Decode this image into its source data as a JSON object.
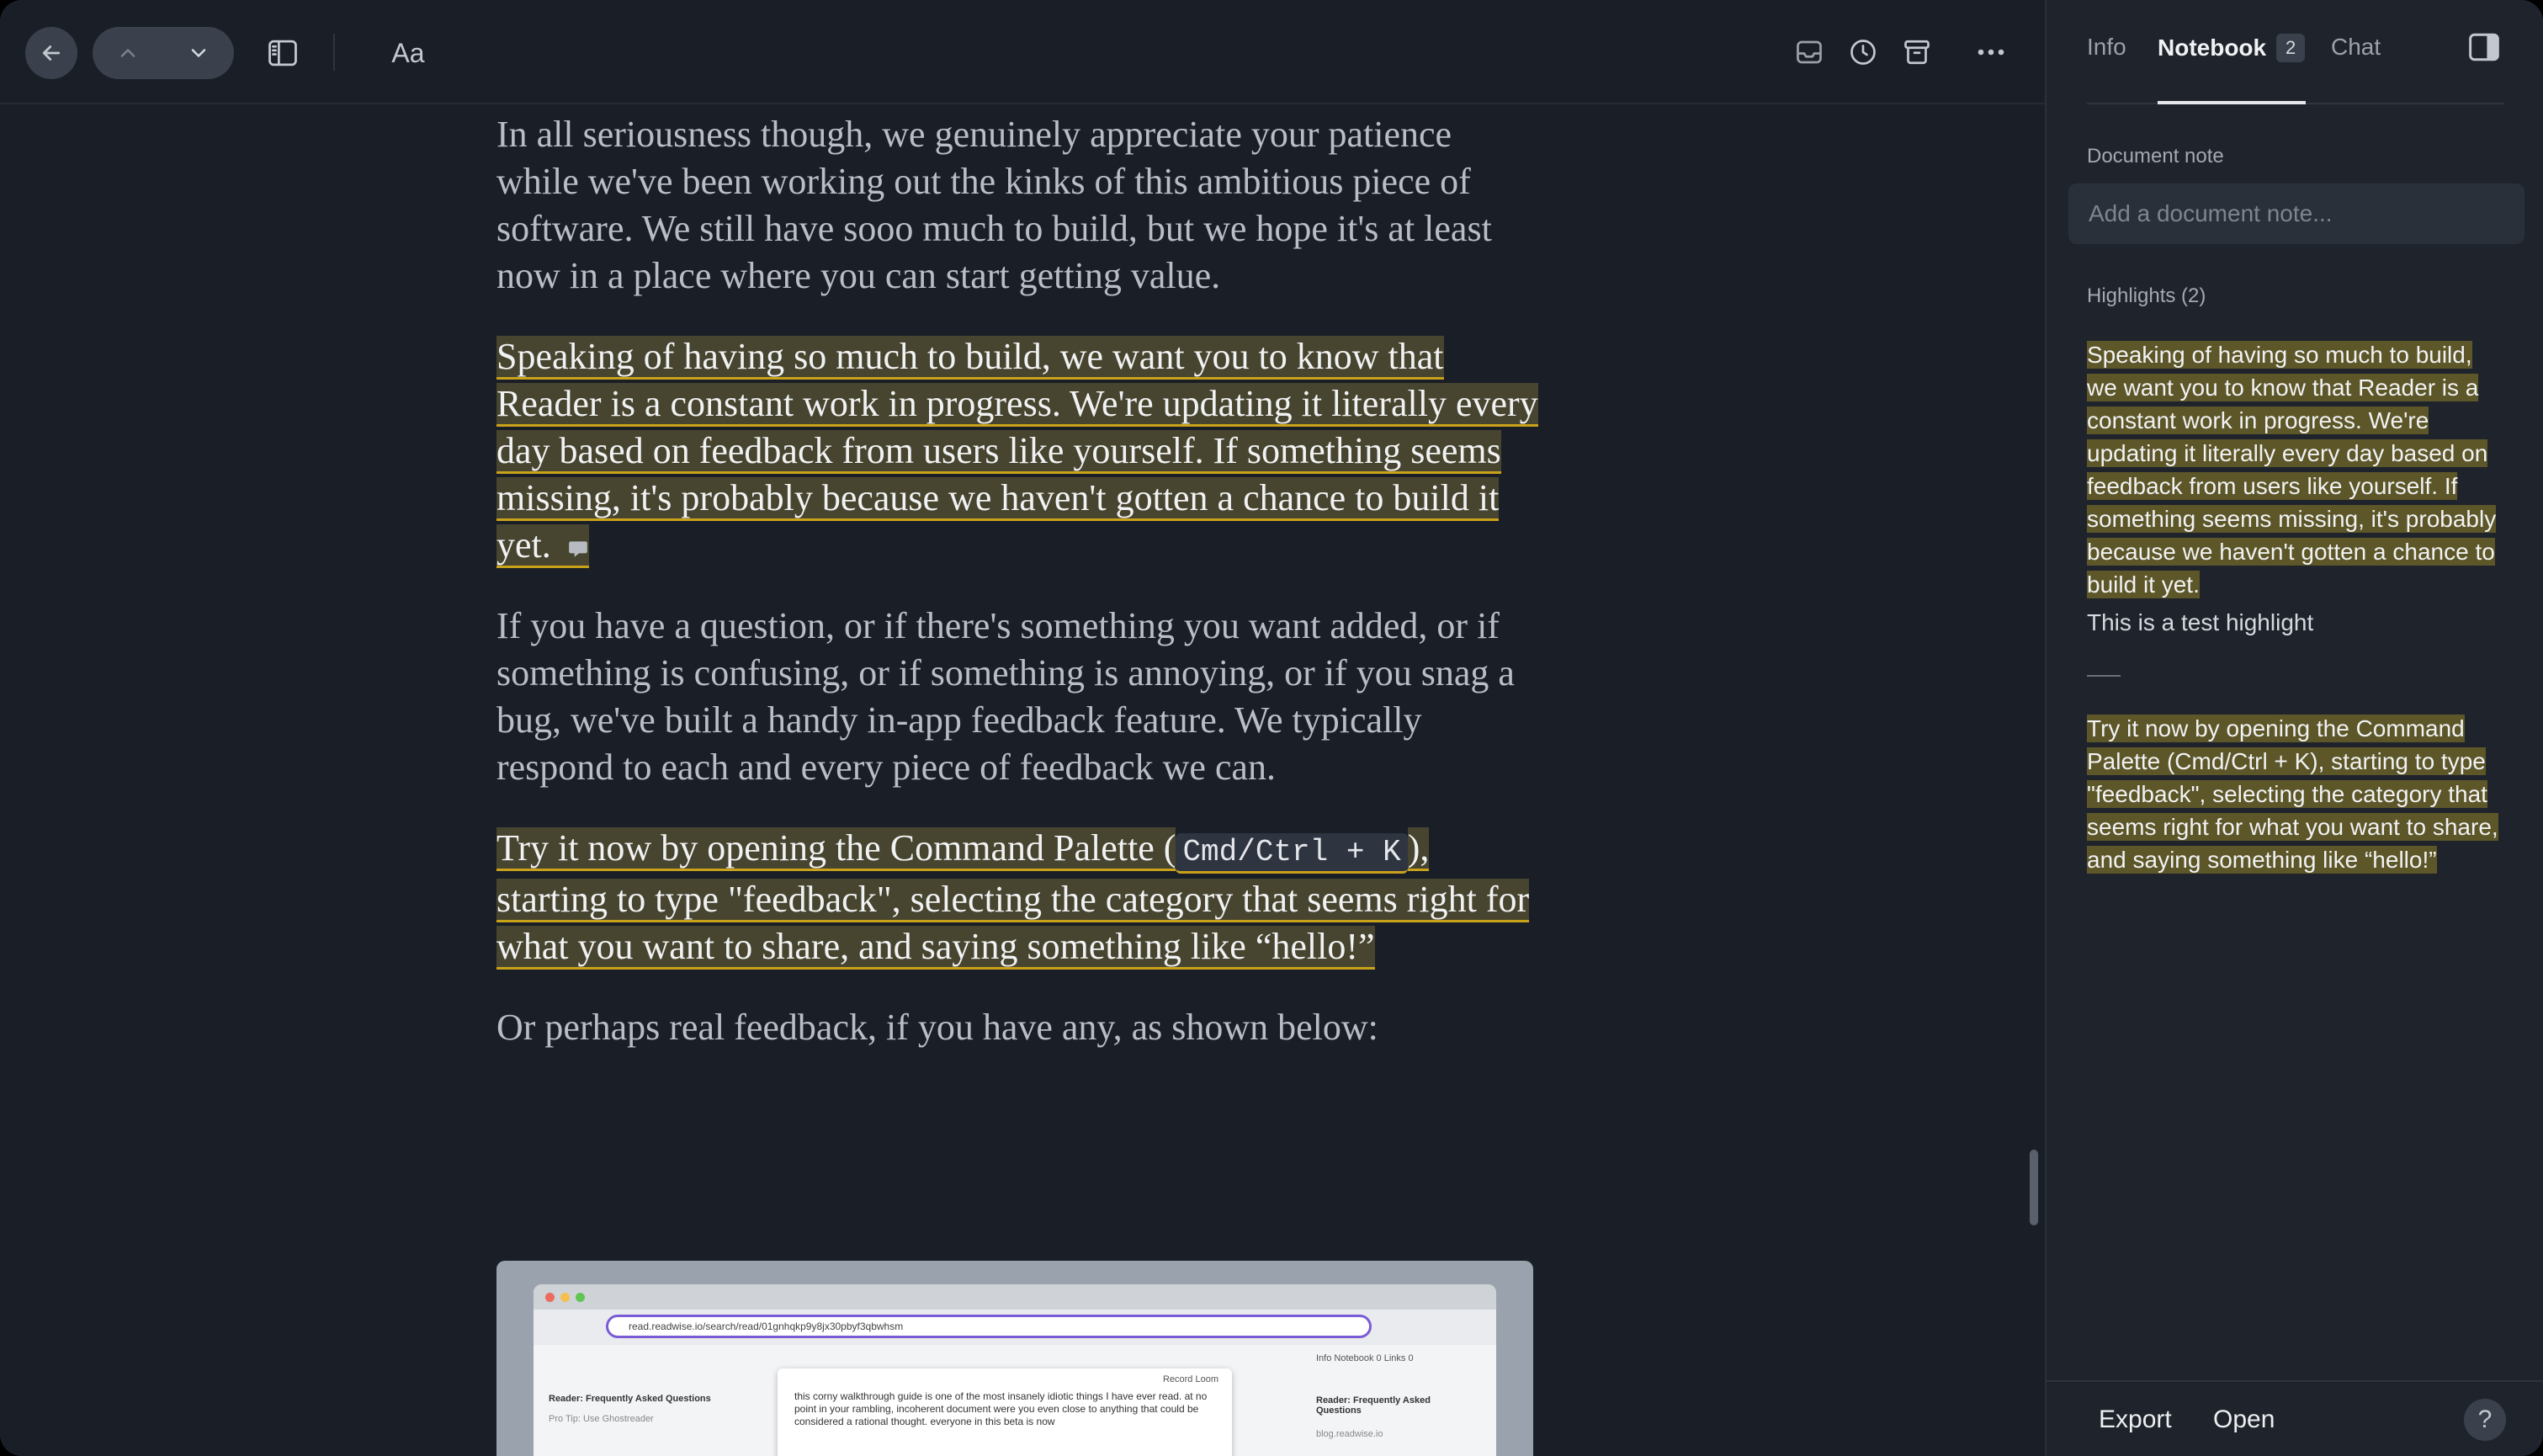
{
  "toolbar": {
    "font_label": "Aa",
    "icons": [
      "back-arrow-icon",
      "chevron-up-icon",
      "chevron-down-icon",
      "sidebar-icon",
      "inbox-icon",
      "clock-icon",
      "archive-icon",
      "more-icon"
    ]
  },
  "article": {
    "p1": "In all seriousness though, we genuinely appreciate your patience while we've been working out the kinks of this ambi­tious piece of software. We still have sooo much to build, but we hope it's at least now in a place where you can start getting value.",
    "p2_highlight": "Speaking of having so much to build, we want you to know that Reader is a constant work in progress. We're updating it literally every day based on feedback from users like yourself. If something seems missing, it's probably because we haven't gotten a chance to build it yet.",
    "p3": "If you have a question, or if there's something you want added, or if something is confusing, or if something is annoying, or if you snag a bug, we've built a handy in-app feedback feature. We typically respond to each and every piece of feedback we can.",
    "p4_before": "Try it now by opening the Command Palette (",
    "p4_code": "Cmd/Ctrl + K",
    "p4_after": "), starting to type \"feedback\", selecting the category that seems right for what you want to share, and saying something like “hello!”",
    "p5": "Or perhaps real feedback, if you have any, as shown below:"
  },
  "embed": {
    "url": "read.readwise.io/search/read/01gnhqkp9y8jx30pbyf3qbwhsm",
    "record_label": "Record Loom",
    "modal_text": "this corny walkthrough guide is one of the most insanely idiotic things I have ever read. at no point in your rambling, incoherent document were you even close to anything that could be considered a rational thought. everyone in this beta is now",
    "sidebar_item_1": "Reader: Frequently Asked Questions",
    "sidebar_item_2": "Pro Tip: Use Ghostreader",
    "right_tabs": "Info   Notebook 0   Links 0",
    "right_title": "Reader: Frequently Asked Questions",
    "right_url": "blog.readwise.io"
  },
  "panel": {
    "tabs": {
      "info": "Info",
      "notebook": "Notebook",
      "notebook_count": "2",
      "chat": "Chat"
    },
    "document_note_label": "Document note",
    "document_note_placeholder": "Add a document note...",
    "highlights_label": "Highlights (2)",
    "highlights": [
      {
        "text": "Speaking of having so much to build, we want you to know that Reader is a constant work in progress. We're updating it literally every day based on feedback from users like yourself. If something seems missing, it's probably because we haven't gotten a chance to build it yet.",
        "note": "This is a test highlight"
      },
      {
        "text": "Try it now by opening the Command Palette (Cmd/Ctrl + K), starting to type \"feedback\", selecting the category that seems right for what you want to share, and saying something like “hello!”"
      }
    ],
    "footer": {
      "export": "Export",
      "open": "Open",
      "help": "?"
    }
  },
  "colors": {
    "background": "#1a1f27",
    "panel": "#1f242c",
    "highlight": "#47452f",
    "highlight_underline": "#c9a21a"
  }
}
